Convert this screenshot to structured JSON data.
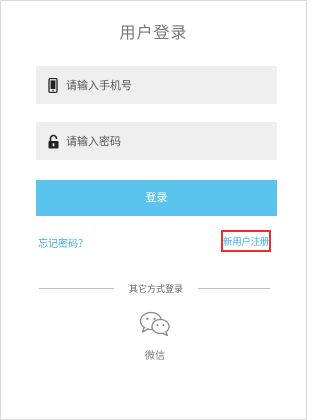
{
  "login": {
    "title": "用户登录",
    "phone_placeholder": "请输入手机号",
    "password_placeholder": "请输入密码",
    "login_button": "登录",
    "forgot_password": "忘记密码？",
    "register": "新用户注册",
    "other_methods": "其它方式登录",
    "wechat_label": "微信"
  },
  "colors": {
    "accent": "#5bc4ee",
    "link": "#3ab0e2",
    "highlight_border": "#e5312a",
    "input_bg": "#efefef"
  },
  "icons": [
    "phone-icon",
    "lock-icon",
    "wechat-icon"
  ]
}
